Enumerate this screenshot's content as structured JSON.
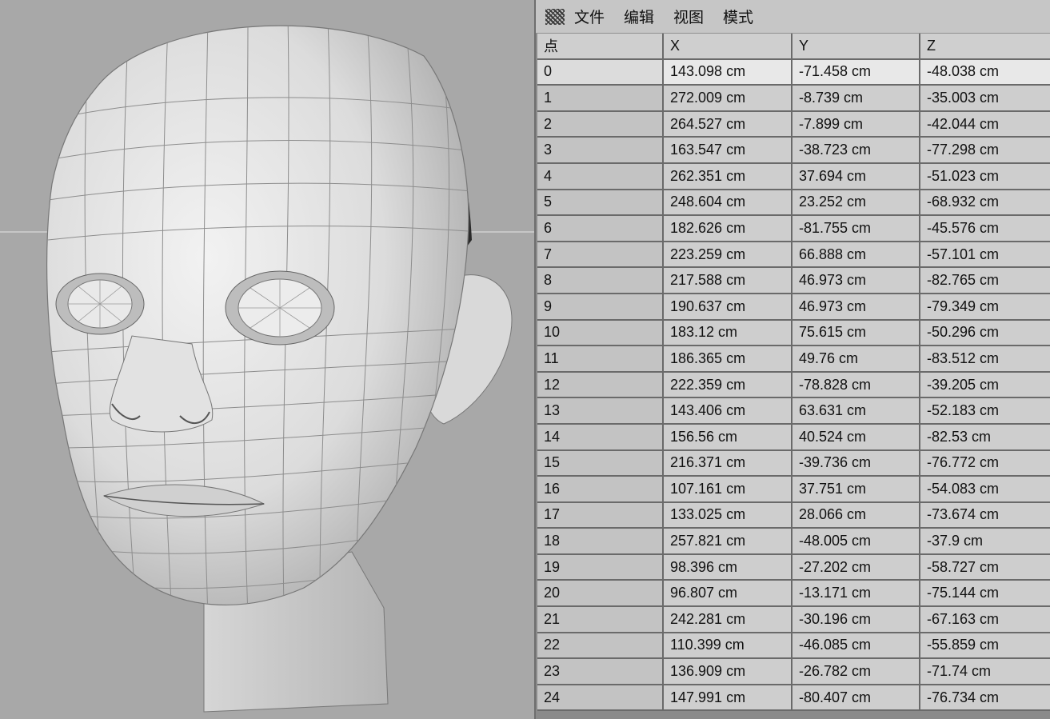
{
  "menu": [
    "文件",
    "编辑",
    "视图",
    "模式"
  ],
  "table": {
    "headers": [
      "点",
      "X",
      "Y",
      "Z"
    ],
    "rows": [
      [
        "0",
        "143.098 cm",
        "-71.458 cm",
        "-48.038 cm"
      ],
      [
        "1",
        "272.009 cm",
        "-8.739 cm",
        "-35.003 cm"
      ],
      [
        "2",
        "264.527 cm",
        "-7.899 cm",
        "-42.044 cm"
      ],
      [
        "3",
        "163.547 cm",
        "-38.723 cm",
        "-77.298 cm"
      ],
      [
        "4",
        "262.351 cm",
        "37.694 cm",
        "-51.023 cm"
      ],
      [
        "5",
        "248.604 cm",
        "23.252 cm",
        "-68.932 cm"
      ],
      [
        "6",
        "182.626 cm",
        "-81.755 cm",
        "-45.576 cm"
      ],
      [
        "7",
        "223.259 cm",
        "66.888 cm",
        "-57.101 cm"
      ],
      [
        "8",
        "217.588 cm",
        "46.973 cm",
        "-82.765 cm"
      ],
      [
        "9",
        "190.637 cm",
        "46.973 cm",
        "-79.349 cm"
      ],
      [
        "10",
        "183.12 cm",
        "75.615 cm",
        "-50.296 cm"
      ],
      [
        "11",
        "186.365 cm",
        "49.76 cm",
        "-83.512 cm"
      ],
      [
        "12",
        "222.359 cm",
        "-78.828 cm",
        "-39.205 cm"
      ],
      [
        "13",
        "143.406 cm",
        "63.631 cm",
        "-52.183 cm"
      ],
      [
        "14",
        "156.56 cm",
        "40.524 cm",
        "-82.53 cm"
      ],
      [
        "15",
        "216.371 cm",
        "-39.736 cm",
        "-76.772 cm"
      ],
      [
        "16",
        "107.161 cm",
        "37.751 cm",
        "-54.083 cm"
      ],
      [
        "17",
        "133.025 cm",
        "28.066 cm",
        "-73.674 cm"
      ],
      [
        "18",
        "257.821 cm",
        "-48.005 cm",
        "-37.9 cm"
      ],
      [
        "19",
        "98.396 cm",
        "-27.202 cm",
        "-58.727 cm"
      ],
      [
        "20",
        "96.807 cm",
        "-13.171 cm",
        "-75.144 cm"
      ],
      [
        "21",
        "242.281 cm",
        "-30.196 cm",
        "-67.163 cm"
      ],
      [
        "22",
        "110.399 cm",
        "-46.085 cm",
        "-55.859 cm"
      ],
      [
        "23",
        "136.909 cm",
        "-26.782 cm",
        "-71.74 cm"
      ],
      [
        "24",
        "147.991 cm",
        "-80.407 cm",
        "-76.734 cm"
      ]
    ],
    "selected_row": 0
  },
  "icons": {
    "grip": "grip-icon"
  },
  "colors": {
    "viewport_bg": "#a8a8a8",
    "panel_bg": "#8a8a8a",
    "cell_bg": "#cecece",
    "selected_bg": "#e8e8e8"
  }
}
